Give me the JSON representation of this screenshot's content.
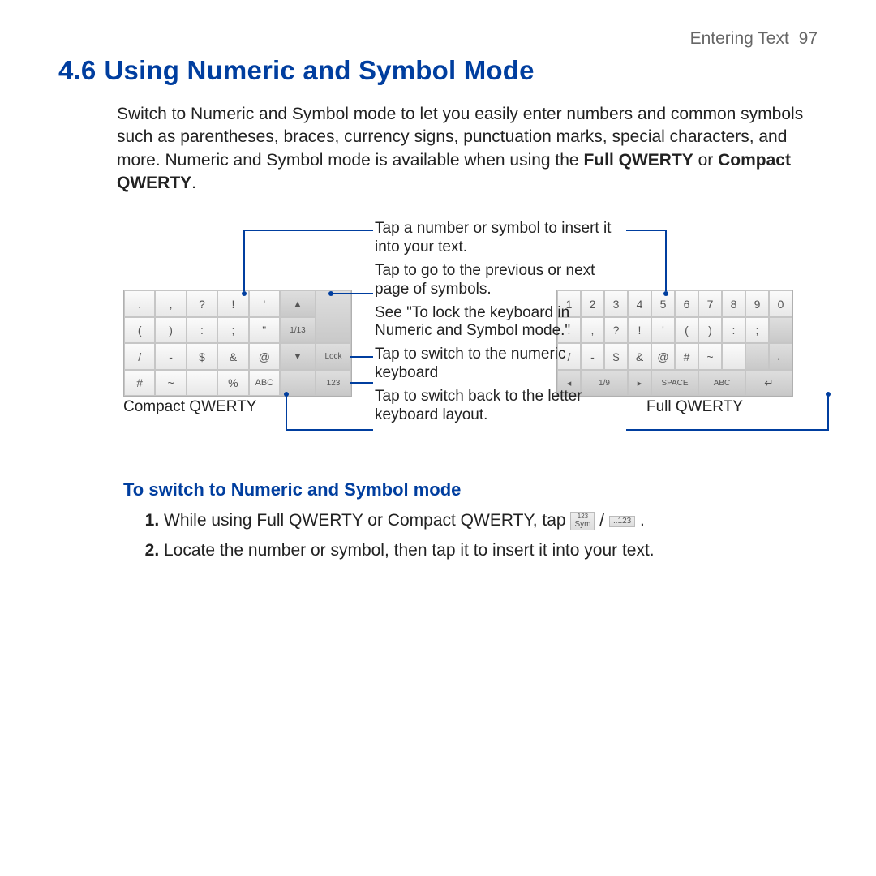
{
  "header": {
    "section": "Entering Text",
    "page": "97"
  },
  "title": {
    "num": "4.6",
    "text": "Using Numeric and Symbol Mode"
  },
  "intro": {
    "p1": "Switch to Numeric and Symbol mode to let you easily enter numbers and common symbols such as parentheses, braces, currency signs, punctuation marks, special characters, and more. Numeric and Symbol mode is available when using the ",
    "b1": "Full QWERTY",
    "mid": " or ",
    "b2": "Compact QWERTY",
    "tail": "."
  },
  "callouts": {
    "c1": "Tap a number or symbol to insert it into your text.",
    "c2": "Tap to go to the previous or next page of symbols.",
    "c3": "See \"To lock the keyboard in Numeric and Symbol mode.\"",
    "c4": "Tap to switch to the numeric keyboard",
    "c5": "Tap to switch back to the letter keyboard layout."
  },
  "captions": {
    "compact": "Compact QWERTY",
    "full": "Full QWERTY"
  },
  "compact": {
    "r1": [
      ".",
      ",",
      "?",
      "!",
      "'"
    ],
    "r2": [
      "(",
      ")",
      ":",
      ";",
      "\""
    ],
    "r3": [
      "/",
      "-",
      "$",
      "&",
      "@"
    ],
    "r4": [
      "#",
      "~",
      "_",
      "%",
      "ABC"
    ],
    "pager_up": "▲",
    "pager_mid": "1/13",
    "pager_dn": "▼",
    "lock": "Lock",
    "n123": "123"
  },
  "full": {
    "r1": [
      "1",
      "2",
      "3",
      "4",
      "5",
      "6",
      "7",
      "8",
      "9",
      "0"
    ],
    "r2": [
      ".",
      ",",
      "?",
      "!",
      "'",
      "(",
      ")",
      ":",
      ";",
      ""
    ],
    "r3": [
      "/",
      "-",
      "$",
      "&",
      "@",
      "#",
      "~",
      "_",
      "",
      "←"
    ],
    "r4_left": "◂",
    "r4_mid": "1/9",
    "r4_right": "▸",
    "r4_space": "SPACE",
    "r4_abc": "ABC",
    "r4_ent": "↵"
  },
  "subhead": "To switch to Numeric and Symbol mode",
  "steps": {
    "s1a": "While using Full QWERTY or Compact QWERTY, tap ",
    "s1_sep": " / ",
    "s1b": ".",
    "s2": "Locate the number or symbol, then tap it to insert it into your text."
  },
  "inline_keys": {
    "sym_top": "123",
    "sym": "Sym",
    "num": "..123"
  }
}
